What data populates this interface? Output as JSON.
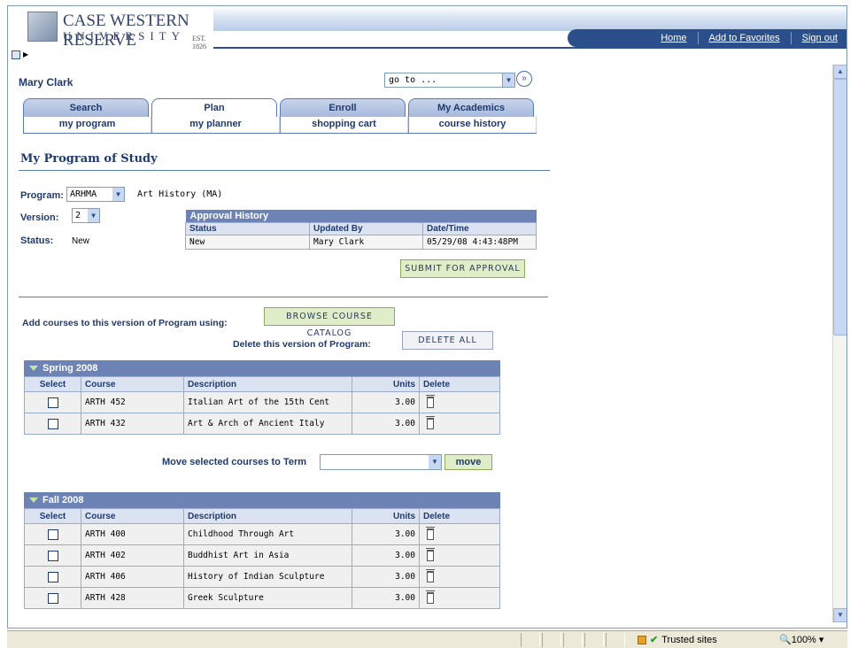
{
  "header": {
    "logo_line1": "CASE WESTERN RESERVE",
    "logo_line2": "UNIVERSITY",
    "logo_est": "EST. 1826",
    "nav": [
      "Home",
      "Add to Favorites",
      "Sign out"
    ]
  },
  "user_name": "Mary Clark",
  "goto": {
    "value": "go to ..."
  },
  "tabs": [
    "Search",
    "Plan",
    "Enroll",
    "My Academics"
  ],
  "active_tab": "Plan",
  "subtabs": [
    "my program",
    "my planner",
    "shopping cart",
    "course history"
  ],
  "page_title": "My Program of Study",
  "program": {
    "program_label": "Program:",
    "program_value": "ARHMA",
    "program_name": "Art History (MA)",
    "version_label": "Version:",
    "version_value": "2",
    "status_label": "Status:",
    "status_value": "New"
  },
  "approval_history": {
    "title": "Approval History",
    "columns": [
      "Status",
      "Updated By",
      "Date/Time"
    ],
    "rows": [
      [
        "New",
        "Mary Clark",
        "05/29/08 4:43:48PM"
      ]
    ]
  },
  "buttons": {
    "submit": "SUBMIT FOR APPROVAL",
    "browse": "BROWSE COURSE CATALOG",
    "delete_all": "DELETE ALL",
    "move": "move"
  },
  "labels": {
    "add_courses": "Add courses to this version of Program using:",
    "delete_version": "Delete this version of Program:",
    "move_selected": "Move selected courses to Term"
  },
  "grid_columns": [
    "Select",
    "Course",
    "Description",
    "Units",
    "Delete"
  ],
  "terms": [
    {
      "name": "Spring 2008",
      "courses": [
        {
          "course": "ARTH 452",
          "description": "Italian Art of the 15th Cent",
          "units": "3.00"
        },
        {
          "course": "ARTH 432",
          "description": "Art & Arch of Ancient Italy",
          "units": "3.00"
        }
      ]
    },
    {
      "name": "Fall 2008",
      "courses": [
        {
          "course": "ARTH 400",
          "description": "Childhood Through Art",
          "units": "3.00"
        },
        {
          "course": "ARTH 402",
          "description": "Buddhist Art in Asia",
          "units": "3.00"
        },
        {
          "course": "ARTH 406",
          "description": "History of Indian Sculpture",
          "units": "3.00"
        },
        {
          "course": "ARTH 428",
          "description": "Greek Sculpture",
          "units": "3.00"
        }
      ]
    }
  ],
  "statusbar": {
    "zone": "Trusted sites",
    "zoom": "100%"
  }
}
